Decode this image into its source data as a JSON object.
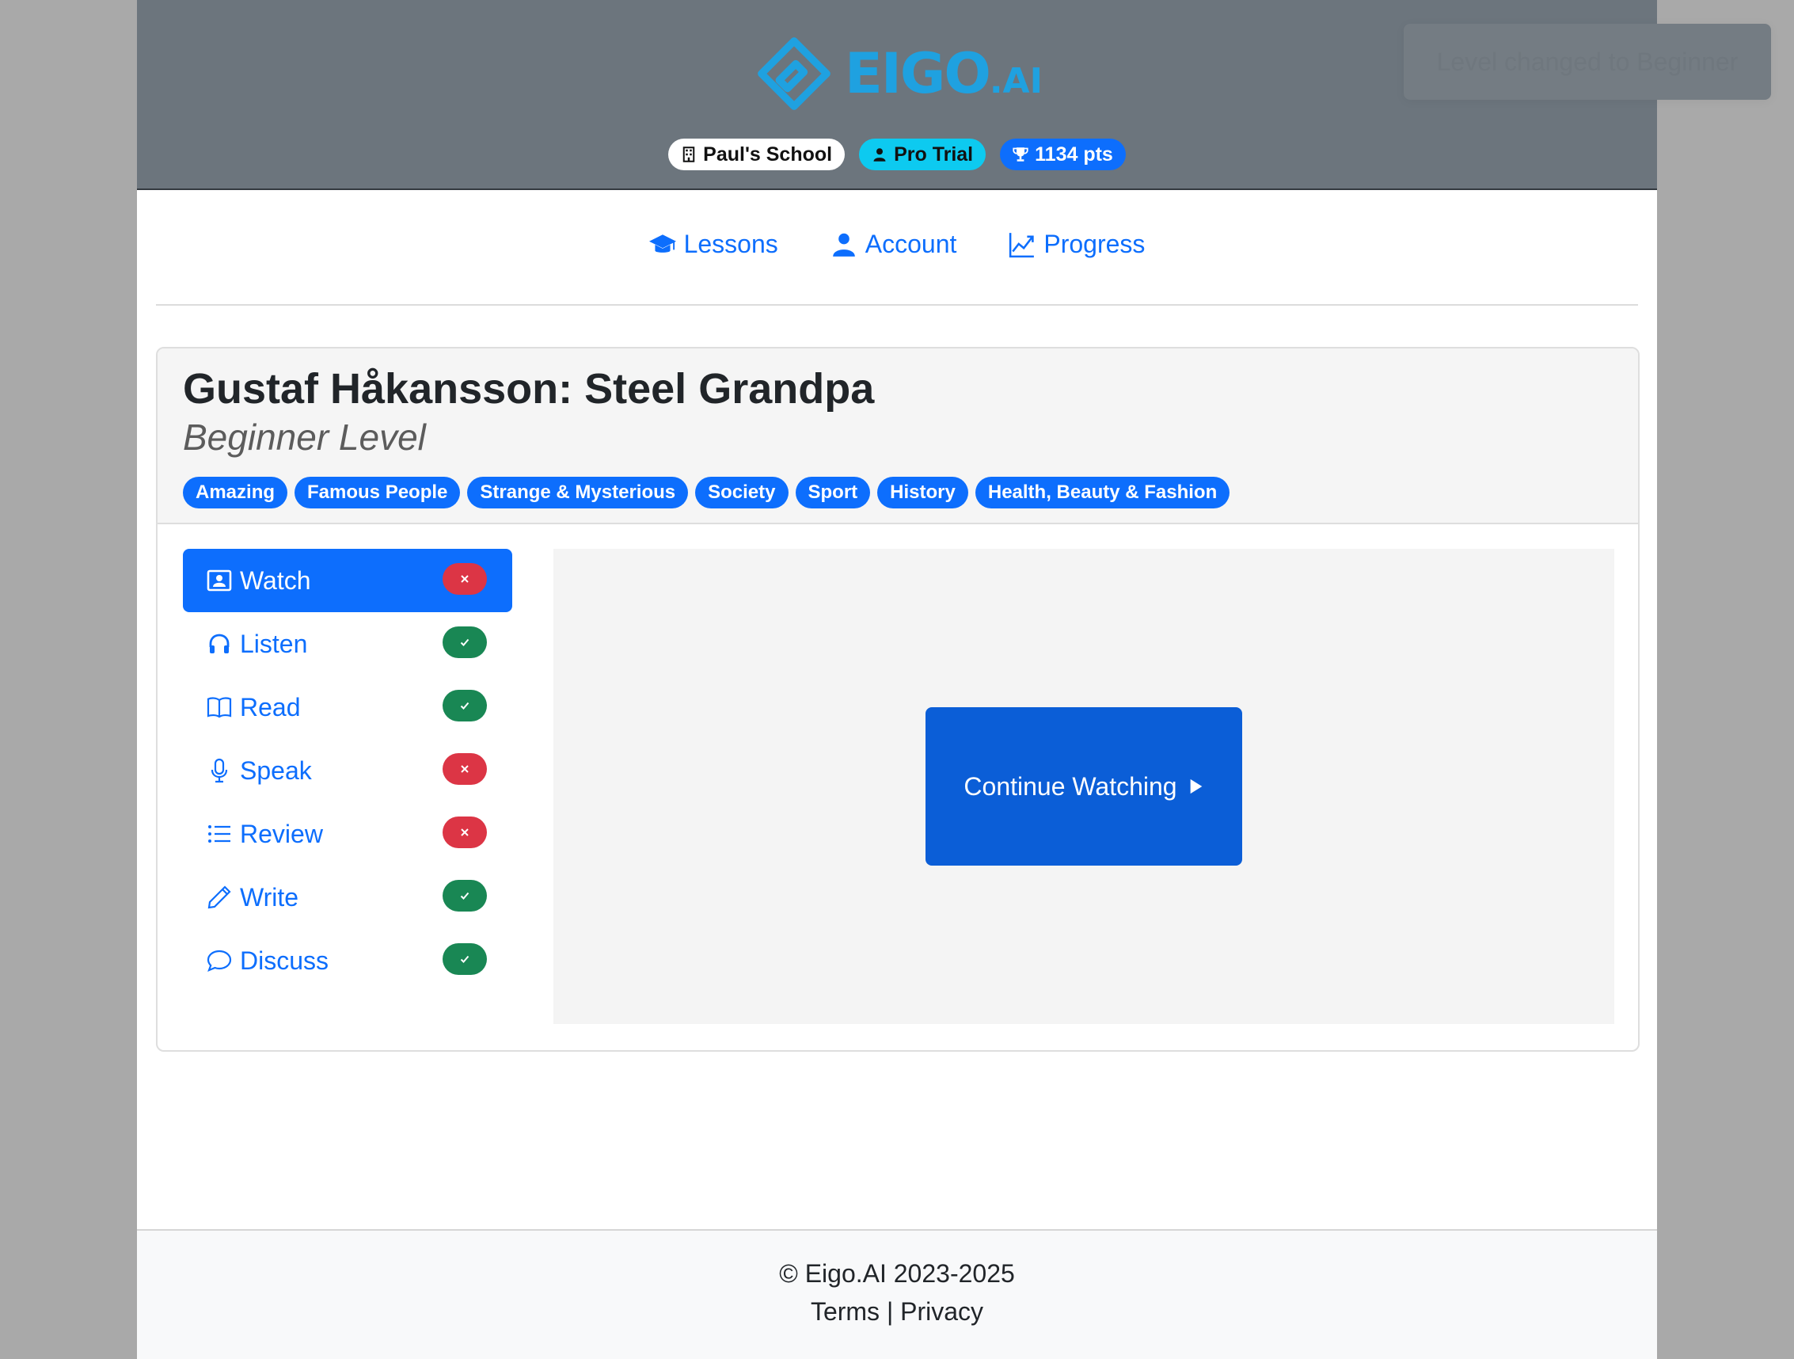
{
  "header": {
    "logo_text": "EIGO",
    "logo_suffix": ".AI",
    "toast": "Level changed to Beginner",
    "badges": {
      "school": "Paul's School",
      "plan": "Pro Trial",
      "points": "1134 pts"
    }
  },
  "nav": {
    "items": [
      {
        "label": "Lessons",
        "icon": "graduation-cap-icon"
      },
      {
        "label": "Account",
        "icon": "person-icon"
      },
      {
        "label": "Progress",
        "icon": "graph-up-icon"
      }
    ]
  },
  "lesson": {
    "title": "Gustaf Håkansson: Steel Grandpa",
    "level": "Beginner Level",
    "tags": [
      "Amazing",
      "Famous People",
      "Strange & Mysterious",
      "Society",
      "Sport",
      "History",
      "Health, Beauty & Fashion"
    ]
  },
  "menu": {
    "items": [
      {
        "label": "Watch",
        "icon": "video-person-icon",
        "status": "incomplete",
        "active": true
      },
      {
        "label": "Listen",
        "icon": "headphones-icon",
        "status": "complete",
        "active": false
      },
      {
        "label": "Read",
        "icon": "book-icon",
        "status": "complete",
        "active": false
      },
      {
        "label": "Speak",
        "icon": "mic-icon",
        "status": "incomplete",
        "active": false
      },
      {
        "label": "Review",
        "icon": "list-icon",
        "status": "incomplete",
        "active": false
      },
      {
        "label": "Write",
        "icon": "pencil-icon",
        "status": "complete",
        "active": false
      },
      {
        "label": "Discuss",
        "icon": "chat-icon",
        "status": "complete",
        "active": false
      }
    ]
  },
  "player": {
    "cta_label": "Continue Watching"
  },
  "footer": {
    "copyright": "© Eigo.AI 2023-2025",
    "terms": "Terms",
    "separator": " | ",
    "privacy": "Privacy"
  },
  "colors": {
    "primary": "#0d6efd",
    "success": "#198754",
    "danger": "#dc3545",
    "info": "#0dcaf0",
    "header_bg": "#6c757d",
    "logo": "#1fa1e0"
  }
}
